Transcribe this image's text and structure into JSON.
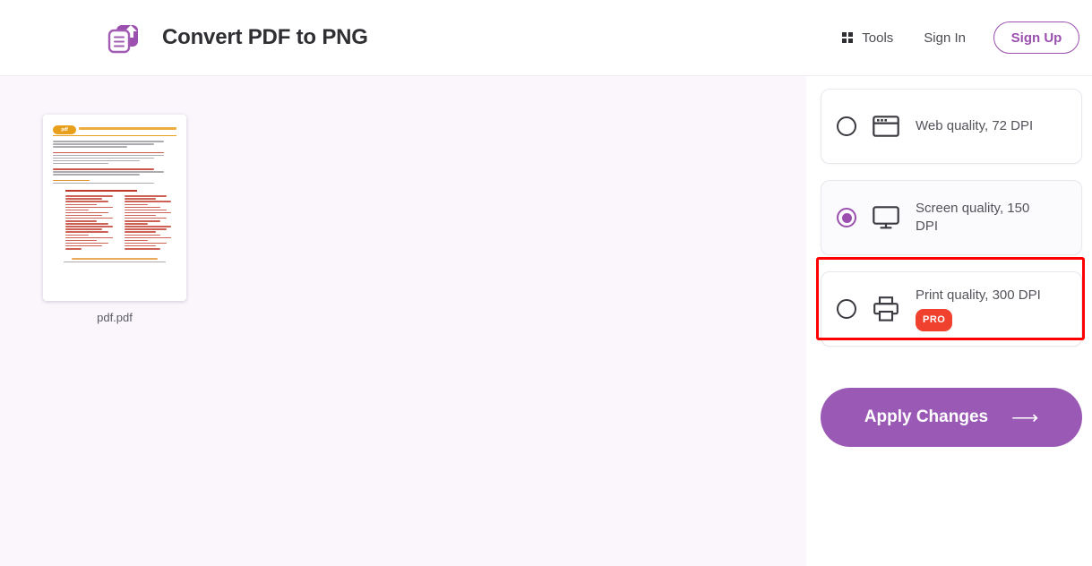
{
  "header": {
    "logo_icon": "pdf-to-png-logo-icon",
    "title": "Convert PDF to PNG",
    "nav": {
      "tools_label": "Tools",
      "tools_icon": "grid-dots-icon",
      "signin_label": "Sign In",
      "signup_label": "Sign Up"
    }
  },
  "workspace": {
    "file": {
      "name": "pdf.pdf",
      "preview_alt": "pdf-page-thumbnail"
    }
  },
  "options_panel": {
    "options": [
      {
        "id": "web",
        "label": "Web quality, 72 DPI",
        "icon": "browser-window-icon",
        "selected": false,
        "pro": false
      },
      {
        "id": "screen",
        "label": "Screen quality, 150 DPI",
        "icon": "monitor-icon",
        "selected": true,
        "pro": false
      },
      {
        "id": "print",
        "label": "Print quality, 300 DPI",
        "icon": "printer-icon",
        "selected": false,
        "pro": true,
        "pro_label": "PRO"
      }
    ],
    "apply_button": {
      "label": "Apply Changes",
      "arrow_icon": "arrow-right-icon"
    },
    "highlight": {
      "target": "screen",
      "color": "#ff0000"
    }
  },
  "colors": {
    "brand_purple": "#9b4fae",
    "apply_purple": "#9b59b6",
    "workspace_bg": "#faf6fc",
    "panel_bg": "#ffffff",
    "pro_red": "#f0412e",
    "highlight_red": "#ff0000",
    "text_dark": "#2f2f33",
    "text_muted": "#53535b"
  }
}
